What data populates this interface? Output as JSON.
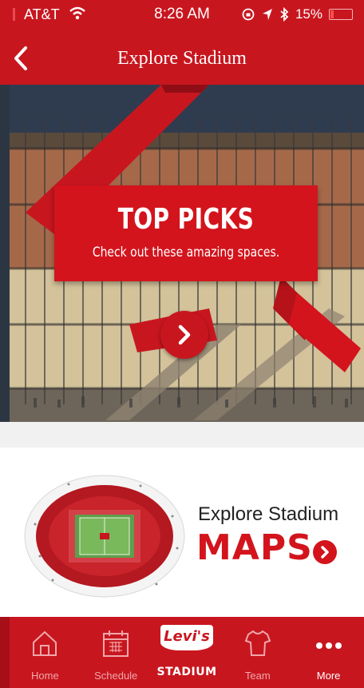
{
  "status_bar": {
    "carrier": "AT&T",
    "time": "8:26 AM",
    "battery": "15%",
    "battery_level": 0.15
  },
  "nav": {
    "title": "Explore Stadium",
    "back_icon": "chevron-left-icon"
  },
  "hero": {
    "title": "TOP PICKS",
    "subtitle": "Check out these amazing spaces.",
    "go_icon": "chevron-right-icon"
  },
  "maps_promo": {
    "line1": "Explore Stadium",
    "line2": "MAPS",
    "go_icon": "chevron-right-icon"
  },
  "tabs": [
    {
      "label": "Home",
      "icon": "home-icon",
      "active": false
    },
    {
      "label": "Schedule",
      "icon": "calendar-icon",
      "active": false
    },
    {
      "label": "STADIUM",
      "icon": "levis-logo",
      "badge": "Levi's",
      "active": true
    },
    {
      "label": "Team",
      "icon": "jersey-icon",
      "active": false
    },
    {
      "label": "More",
      "icon": "more-icon",
      "active": true
    }
  ],
  "colors": {
    "brand_red": "#c8161f",
    "accent_red": "#d3141d"
  }
}
